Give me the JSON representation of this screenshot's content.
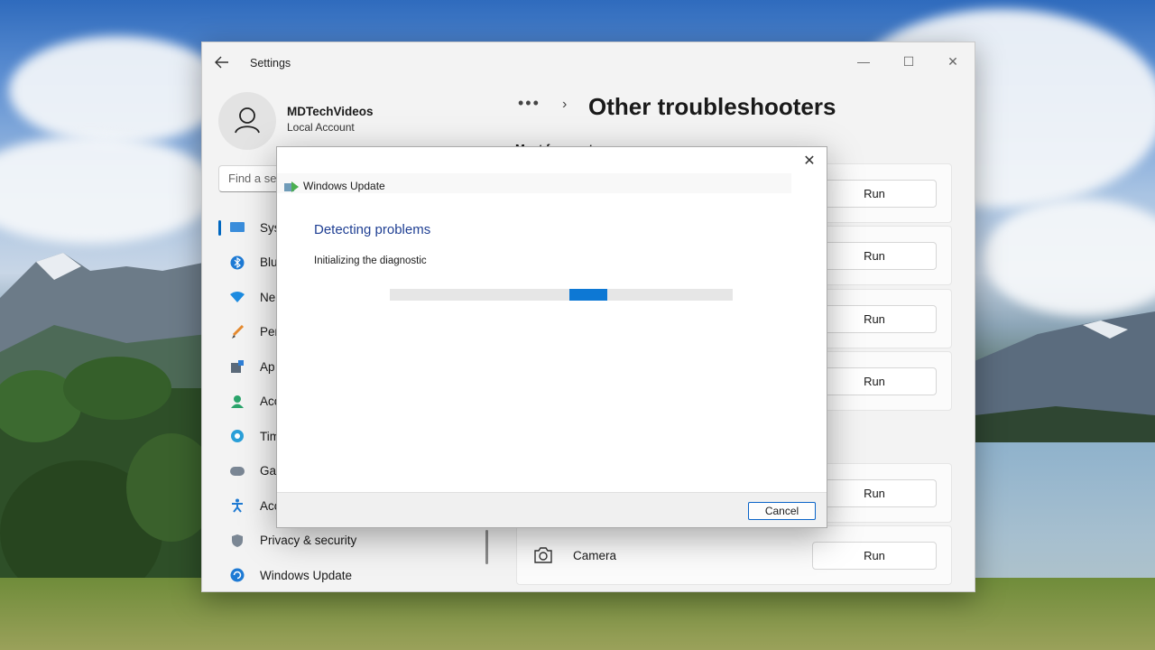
{
  "settings_window": {
    "app_title": "Settings",
    "back_icon": "arrow-left-icon",
    "controls": {
      "minimize": "—",
      "maximize": "☐",
      "close": "✕"
    },
    "profile": {
      "name": "MDTechVideos",
      "account_type": "Local Account",
      "avatar_icon": "person-icon"
    },
    "search": {
      "placeholder": "Find a se"
    },
    "nav": {
      "items": [
        {
          "label": "Sys",
          "icon": "system-icon",
          "active": true
        },
        {
          "label": "Blu",
          "icon": "bluetooth-icon",
          "active": false
        },
        {
          "label": "Ne",
          "icon": "network-icon",
          "active": false
        },
        {
          "label": "Per",
          "icon": "personalization-icon",
          "active": false
        },
        {
          "label": "Ap",
          "icon": "apps-icon",
          "active": false
        },
        {
          "label": "Acc",
          "icon": "accounts-icon",
          "active": false
        },
        {
          "label": "Tim",
          "icon": "time-language-icon",
          "active": false
        },
        {
          "label": "Ga",
          "icon": "gaming-icon",
          "active": false
        },
        {
          "label": "Acc",
          "icon": "accessibility-icon",
          "active": false
        },
        {
          "label": "Privacy & security",
          "icon": "shield-icon",
          "active": false
        },
        {
          "label": "Windows Update",
          "icon": "update-icon",
          "active": false
        }
      ]
    },
    "breadcrumb": {
      "dots": "•••",
      "chevron": "›"
    },
    "page_title": "Other troubleshooters",
    "section_label": "Most frequent",
    "troubleshooters": [
      {
        "label": "",
        "button": "Run"
      },
      {
        "label": "",
        "button": "Run"
      },
      {
        "label": "",
        "button": "Run"
      },
      {
        "label": "",
        "button": "Run"
      },
      {
        "label": "",
        "button": "Run"
      },
      {
        "label": "Camera",
        "icon": "camera-icon",
        "button": "Run"
      }
    ]
  },
  "dialog": {
    "app_title": "Windows Update",
    "app_icon": "windows-update-troubleshooter-icon",
    "heading": "Detecting problems",
    "status": "Initializing the diagnostic",
    "progress_fraction": 0.58,
    "cancel_label": "Cancel",
    "close_glyph": "✕",
    "accent_color": "#0d78d4",
    "heading_color": "#1f3f93"
  }
}
